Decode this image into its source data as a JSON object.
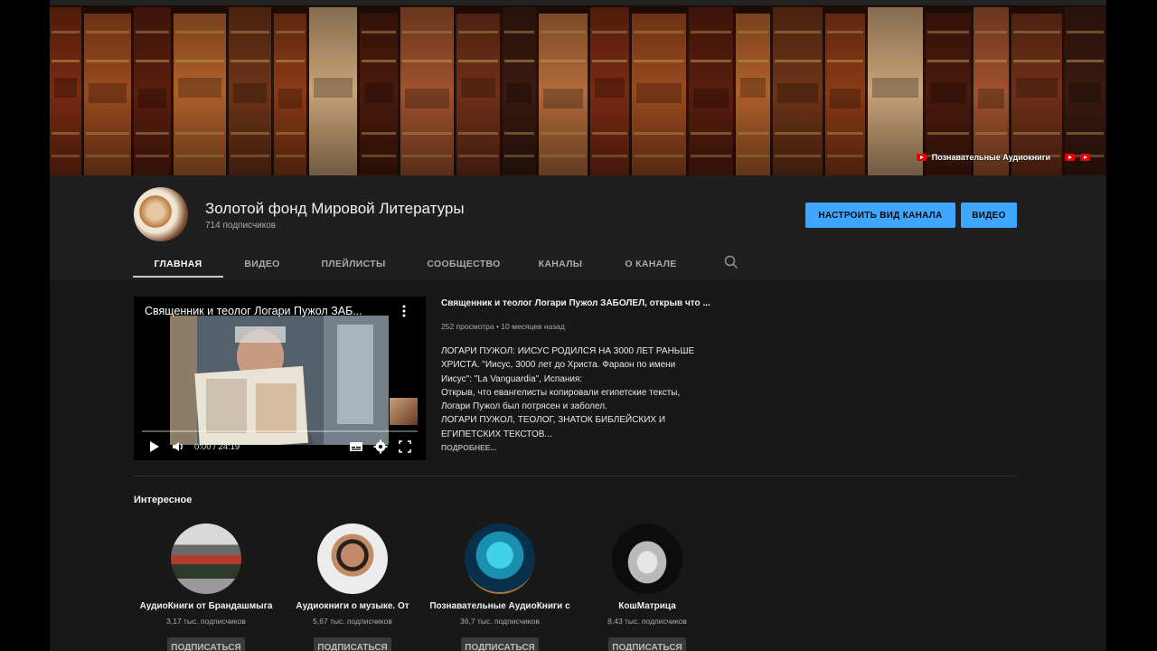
{
  "banner": {
    "link_text": "Познавательные Аудиокниги",
    "link_icon": "youtube-icon"
  },
  "channel": {
    "title": "Золотой фонд Мировой Литературы",
    "subscribers": "714 подписчиков",
    "customize_label": "НАСТРОИТЬ ВИД КАНАЛА",
    "videos_label": "ВИДЕО"
  },
  "tabs": [
    {
      "label": "ГЛАВНАЯ",
      "active": true
    },
    {
      "label": "ВИДЕО"
    },
    {
      "label": "ПЛЕЙЛИСТЫ"
    },
    {
      "label": "СООБЩЕСТВО"
    },
    {
      "label": "КАНАЛЫ"
    },
    {
      "label": "О КАНАЛЕ"
    }
  ],
  "featured": {
    "player_title": "Священник и теолог Логари Пужол ЗАБ...",
    "time": "0:00 / 24:19",
    "progress": 0,
    "title": "Священник и теолог Логари Пужол ЗАБОЛЕЛ, открыв что ...",
    "meta": "252 просмотра • 10 месяцев назад",
    "description": [
      "ЛОГАРИ ПУЖОЛ: ИИСУС РОДИЛСЯ НА 3000 ЛЕТ РАНЬШЕ",
      "ХРИСТА. \"Иисус, 3000 лет до Христа. Фараон по имени",
      "Иисус\": \"La Vanguardia\", Испания:",
      "Открыв, что евангелисты копировали египетские тексты,",
      "Логари Пужол был потрясен и заболел.",
      "ЛОГАРИ ПУЖОЛ, ТЕОЛОГ, ЗНАТОК БИБЛЕЙСКИХ И",
      "ЕГИПЕТСКИХ ТЕКСТОВ..."
    ],
    "more_label": "ПОДРОБНЕЕ..."
  },
  "interesting": {
    "title": "Интересное",
    "channels": [
      {
        "name": "АудиоКниги от Брандашмыга",
        "subs": "3,17 тыс. подписчиков",
        "button": "ПОДПИСАТЬСЯ"
      },
      {
        "name": "Аудиокниги о музыке. От",
        "subs": "5,67 тыс. подписчиков",
        "button": "ПОДПИСАТЬСЯ"
      },
      {
        "name": "Познавательные АудиоКниги с",
        "subs": "36,7 тыс. подписчиков",
        "button": "ПОДПИСАТЬСЯ"
      },
      {
        "name": "КошМатрица",
        "subs": "8,43 тыс. подписчиков",
        "button": "ПОДПИСАТЬСЯ"
      }
    ]
  }
}
